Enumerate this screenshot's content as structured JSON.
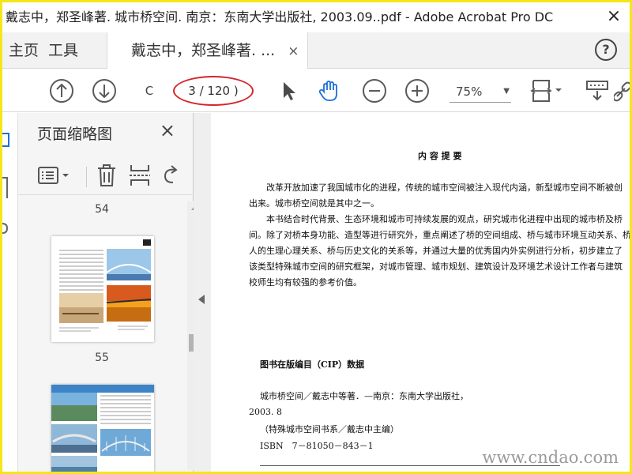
{
  "window": {
    "title": "戴志中，郑圣峰著. 城市桥空间. 南京：东南大学出版社, 2003.09..pdf - Adobe Acrobat Pro DC",
    "close_glyph": "×"
  },
  "tabs": [
    {
      "label": "主页"
    },
    {
      "label": "工具"
    },
    {
      "label": "戴志中，郑圣峰著. ..."
    }
  ],
  "tab_close_glyph": "×",
  "help_glyph": "?",
  "toolbar": {
    "current_page": "C",
    "page_count": "3 / 120 )",
    "zoom": "75%"
  },
  "panel": {
    "title": "页面缩略图",
    "close_glyph": "×",
    "thumbnails": [
      {
        "page": "54"
      },
      {
        "page": "55"
      }
    ]
  },
  "document": {
    "heading": "内 容 提 要",
    "lines": [
      "改革开放加速了我国城市化的进程，传统的城市空间被注入现代内涵，新型城市空间不断被创",
      "出来。城市桥空间就是其中之一。",
      "本书结合时代背景、生态环境和城市可持续发展的观点，研究城市化进程中出现的城市桥及桥",
      "间。除了对桥本身功能、造型等进行研究外，重点阐述了桥的空间组成、桥与城市环境互动关系、桥",
      "人的生理心理关系、桥与历史文化的关系等，并通过大量的优秀国内外实例进行分析，初步建立了",
      "该类型特殊城市空间的研究框架，对城市管理、城市规划、建筑设计及环境艺术设计工作者与建筑",
      "校师生均有较强的参考价值。"
    ],
    "cip_heading": "图书在版编目（CIP）数据",
    "cip_lines": [
      "城市桥空间／戴志中等著．—南京：东南大学出版社，",
      "2003. 8",
      "（特殊城市空间书系／戴志中主编）",
      "ISBN　7－81050－843－1"
    ]
  },
  "watermark": "www.cndao.com",
  "colors": {
    "frame": "#f5e61a",
    "annotation": "#d4242a",
    "hand_tool": "#1d6fd6"
  }
}
